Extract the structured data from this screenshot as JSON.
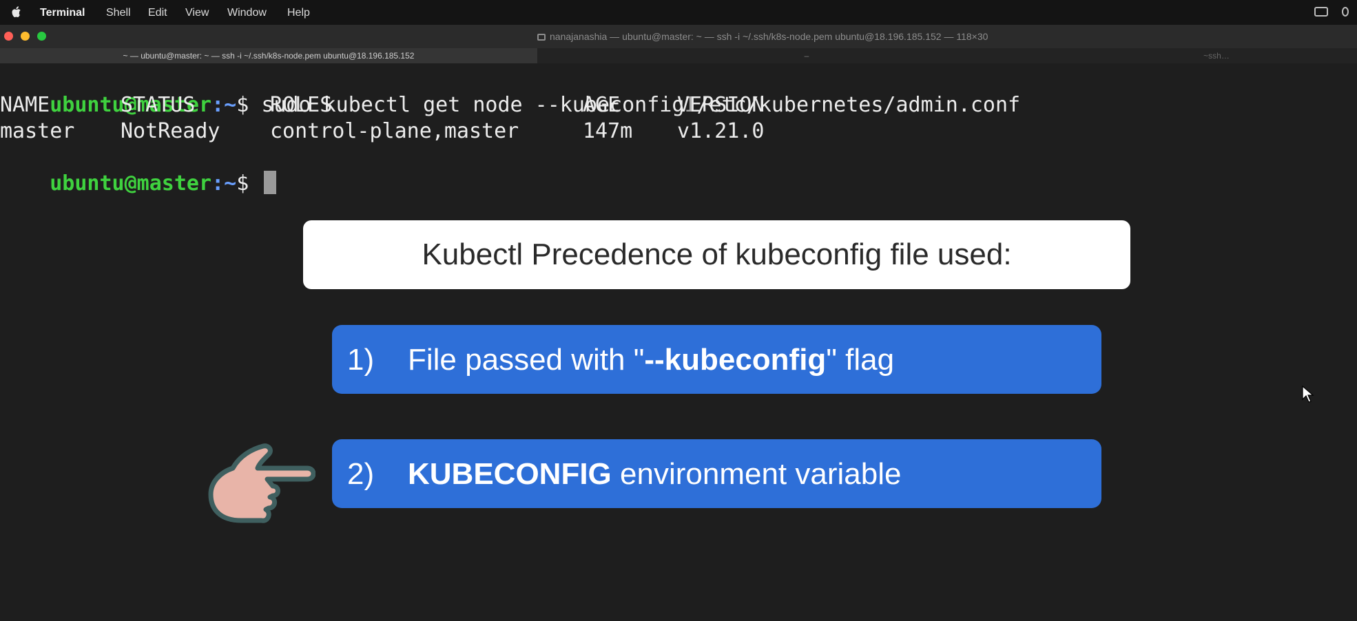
{
  "menubar": {
    "app": "Terminal",
    "items": [
      "Shell",
      "Edit",
      "View",
      "Window",
      "Help"
    ]
  },
  "window": {
    "title": "nanajanashia — ubuntu@master: ~ — ssh -i ~/.ssh/k8s-node.pem ubuntu@18.196.185.152 — 118×30",
    "tabs": [
      "~ — ubuntu@master: ~ — ssh -i ~/.ssh/k8s-node.pem ubuntu@18.196.185.152",
      "–",
      "~ssh…"
    ]
  },
  "terminal": {
    "prompt_user": "ubuntu@master",
    "prompt_path": ":~",
    "prompt_symbol": "$",
    "command_before_cursor": "sudo kubectl get node --kubeconfig",
    "ibeam_glyph": "I",
    "command_after_cursor": "/etc/kubernetes/admin.conf",
    "table": {
      "headers": [
        "NAME",
        "STATUS",
        "ROLES",
        "AGE",
        "VERSION"
      ],
      "rows": [
        [
          "master",
          "NotReady",
          "control-plane,master",
          "147m",
          "v1.21.0"
        ]
      ]
    }
  },
  "slide": {
    "title": "Kubectl Precedence of kubeconfig file used:",
    "items": [
      {
        "number": "1)",
        "pre": "File passed with \"",
        "bold": "--kubeconfig",
        "post": "\" flag"
      },
      {
        "number": "2)",
        "pre": "",
        "bold": "KUBECONFIG",
        "post": " environment variable"
      }
    ]
  },
  "colors": {
    "prompt_user": "#3fd23f",
    "prompt_path": "#6aa0ff",
    "slide_blue": "#2e6fd8",
    "hand_fill": "#e8b4a8"
  }
}
